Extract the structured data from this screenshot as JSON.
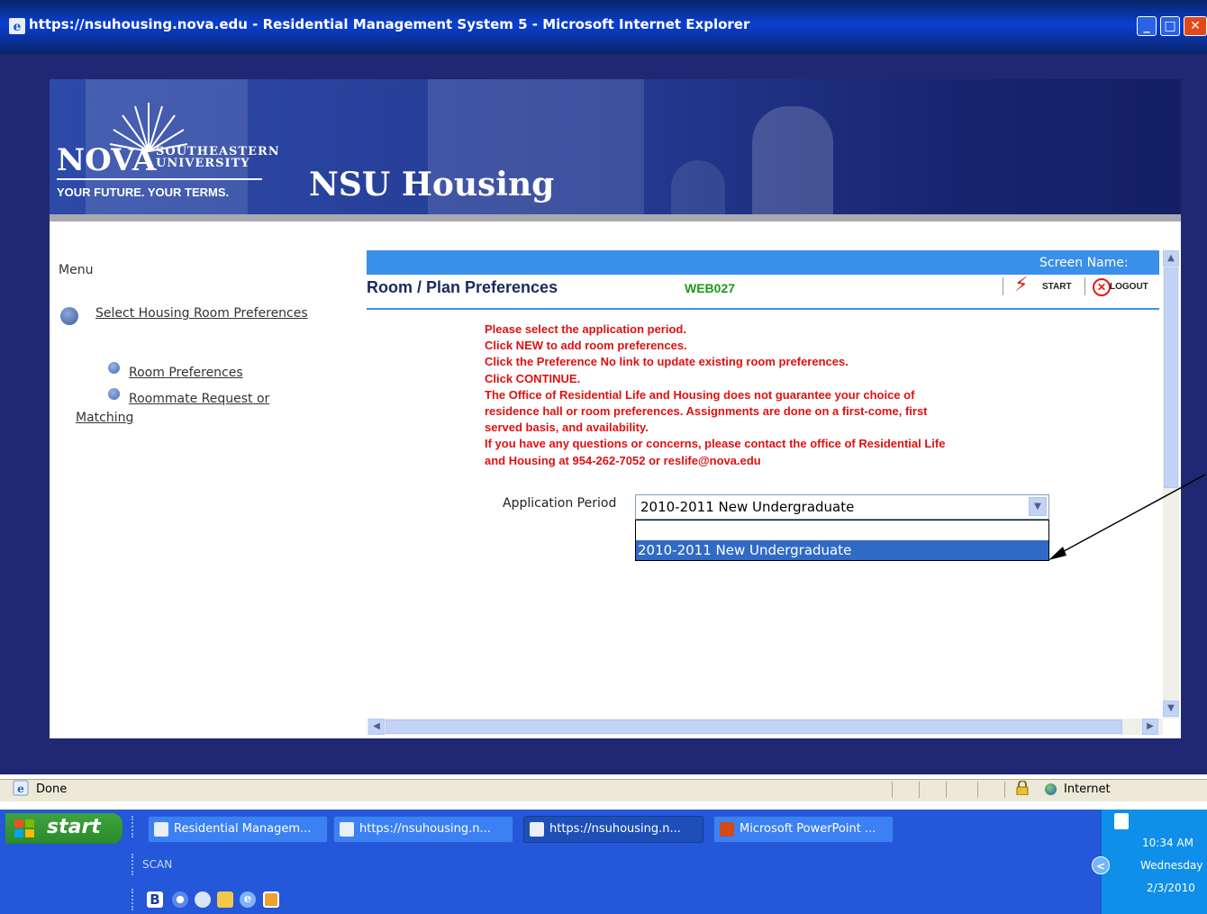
{
  "window": {
    "title": "https://nsuhousing.nova.edu - Residential Management System 5 - Microsoft Internet Explorer",
    "controls": [
      "minimize",
      "maximize",
      "close"
    ]
  },
  "banner": {
    "logo_nova": "NOVA",
    "logo_line1": "SOUTHEASTERN",
    "logo_line2": "UNIVERSITY",
    "tagline": "YOUR FUTURE. YOUR TERMS.",
    "site_name": "NSU Housing"
  },
  "menu": {
    "label": "Menu",
    "main_item": "Select Housing Room Preferences",
    "sub_items": [
      "Room Preferences",
      "Roommate Request or",
      "Matching"
    ]
  },
  "header": {
    "screen_name_label": "Screen Name:",
    "page_title": "Room / Plan Preferences",
    "screen_code": "WEB027",
    "start_label": "START",
    "logout_label": "LOGOUT"
  },
  "instructions": [
    "Please select the application period.",
    "Click NEW to add room preferences.",
    "Click the Preference No link to update existing room preferences.",
    "Click CONTINUE.",
    "The Office of Residential Life and Housing does not guarantee your choice of",
    "residence hall or room preferences. Assignments are done on a first-come, first",
    "served basis, and availability.",
    "If you have any questions or concerns, please contact the office of Residential Life",
    "and Housing at 954-262-7052 or reslife@nova.edu"
  ],
  "form": {
    "application_period_label": "Application Period",
    "selected_value": "2010-2011 New Undergraduate",
    "options": [
      "",
      "2010-2011 New Undergraduate"
    ],
    "highlighted_option": "2010-2011 New Undergraduate"
  },
  "statusbar": {
    "status": "Done",
    "zone": "Internet"
  },
  "taskbar": {
    "start_label": "start",
    "tasks": [
      "Residential Managem...",
      "https://nsuhousing.n...",
      "https://nsuhousing.n...",
      "Microsoft PowerPoint ..."
    ],
    "active_task": "https://nsuhousing.n...",
    "toolbar_label": "SCAN",
    "clock": {
      "time": "10:34 AM",
      "day": "Wednesday",
      "date": "2/3/2010"
    }
  },
  "colors": {
    "instruction_text": "#e01010",
    "header_bar": "#3a8fe8",
    "screen_code": "#1a9a1a",
    "window_bg": "#212873"
  }
}
